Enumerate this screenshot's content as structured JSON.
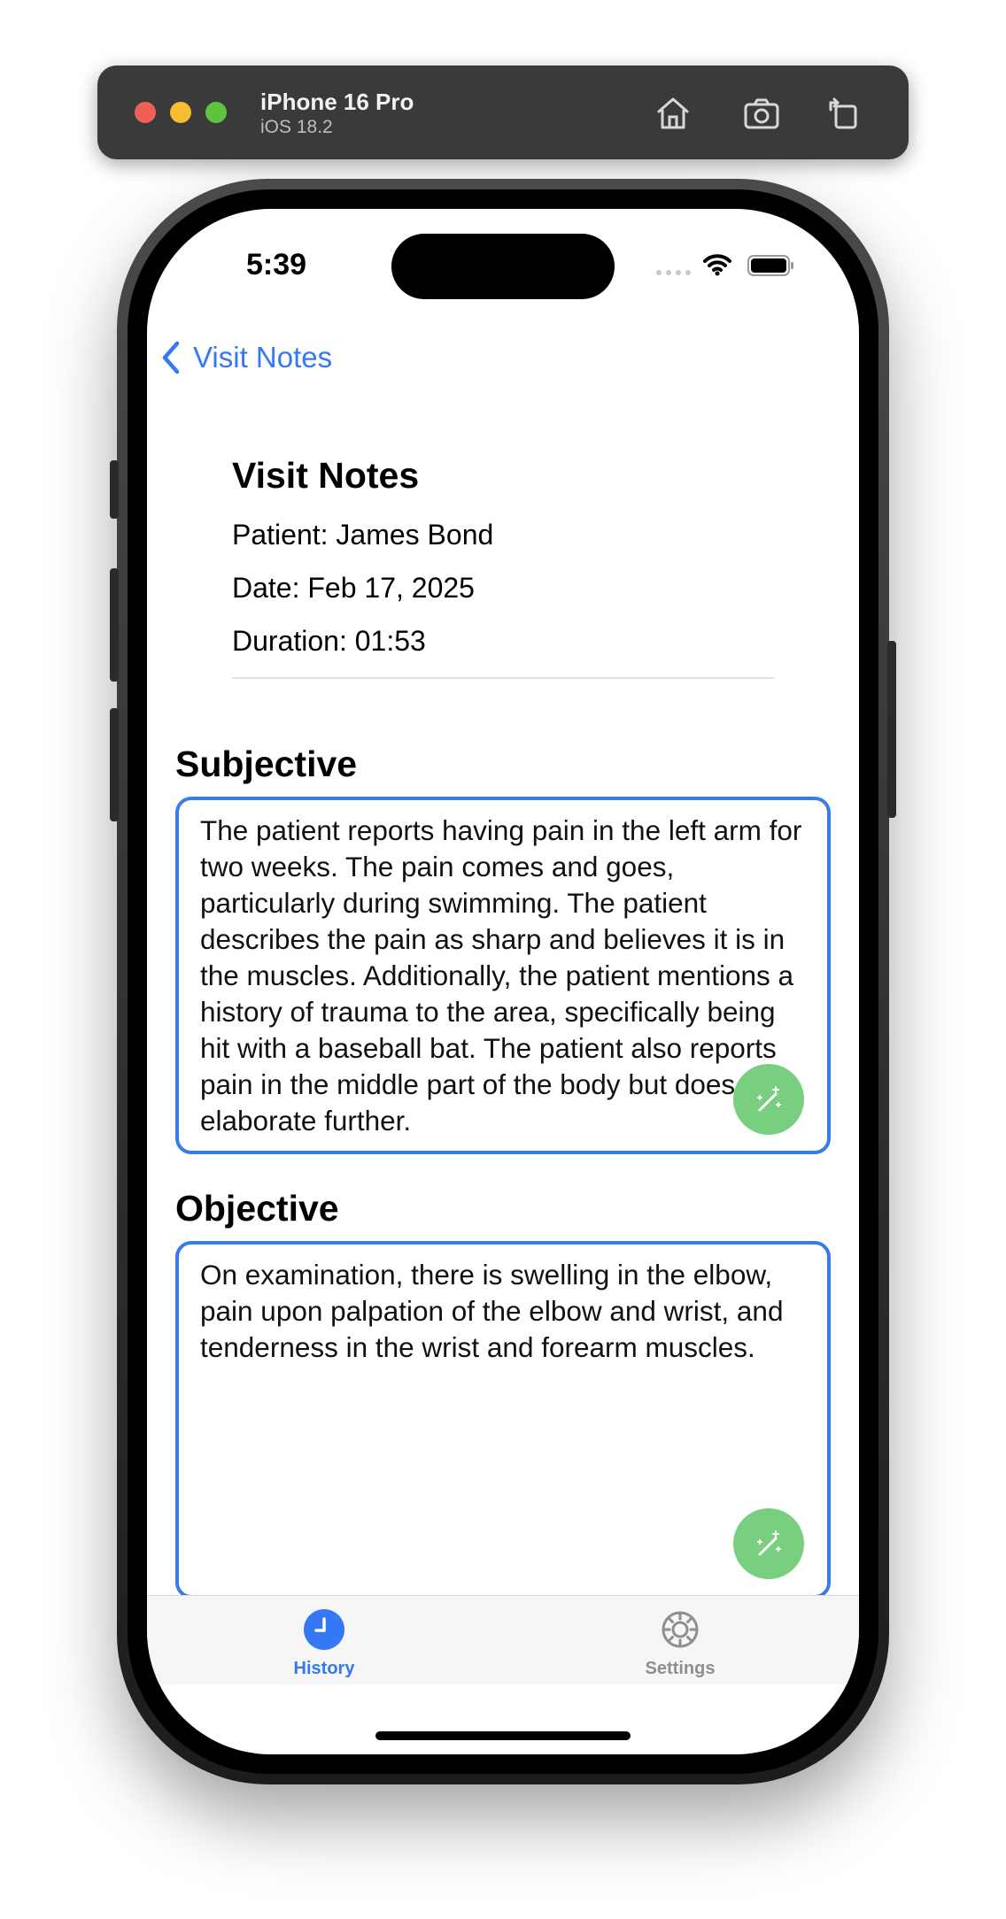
{
  "simulator": {
    "device_name": "iPhone 16 Pro",
    "os_version": "iOS 18.2",
    "icons": [
      "home-icon",
      "screenshot-icon",
      "rotate-icon"
    ]
  },
  "status_bar": {
    "time": "5:39"
  },
  "nav": {
    "back_label": "Visit Notes"
  },
  "header": {
    "title": "Visit Notes",
    "patient": "Patient: James Bond",
    "date": "Date: Feb 17, 2025",
    "duration": "Duration: 01:53"
  },
  "sections": [
    {
      "heading": "Subjective",
      "text": "The patient reports having pain in the left arm for two weeks. The pain comes and goes, particularly during swimming. The patient describes the pain as sharp and believes it is in the muscles. Additionally, the patient mentions a history of trauma to the area, specifically being hit with a baseball bat. The patient also reports pain in the middle part of the body but does not elaborate further."
    },
    {
      "heading": "Objective",
      "text": "On examination, there is swelling in the elbow, pain upon palpation of the elbow and wrist, and tenderness in the wrist and forearm muscles."
    }
  ],
  "tabbar": {
    "tabs": [
      {
        "label": "History",
        "icon": "clock-icon",
        "active": true
      },
      {
        "label": "Settings",
        "icon": "gear-icon",
        "active": false
      }
    ]
  },
  "colors": {
    "accent": "#3478f6",
    "box_border": "#3a7bea",
    "fab": "#78cf80",
    "inactive": "#8e8e93"
  }
}
